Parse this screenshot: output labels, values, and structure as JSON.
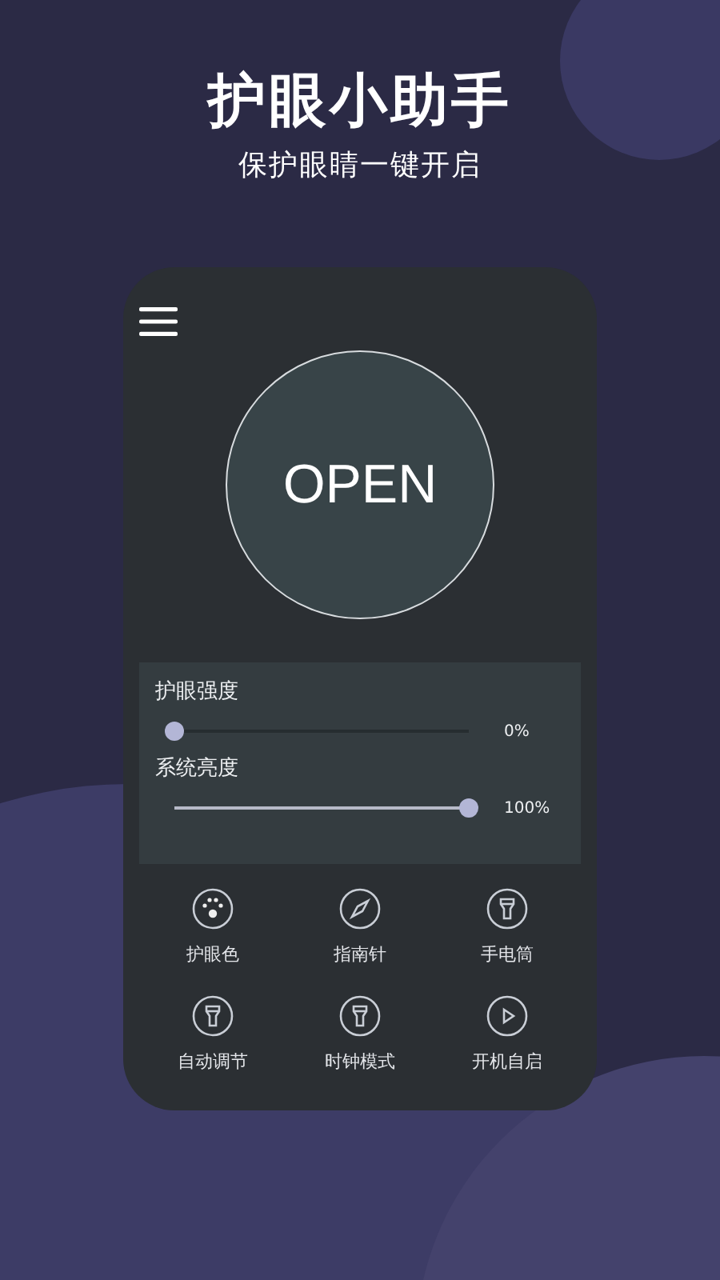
{
  "headline": {
    "title": "护眼小助手",
    "subtitle": "保护眼睛一键开启"
  },
  "app": {
    "power_button": "OPEN",
    "sliders": [
      {
        "label": "护眼强度",
        "level": 0,
        "reading": "0%"
      },
      {
        "label": "系统亮度",
        "level": 1,
        "reading": "100%"
      }
    ],
    "tools": [
      {
        "kind": "palette",
        "label": "护眼色"
      },
      {
        "kind": "compass",
        "label": "指南针"
      },
      {
        "kind": "flashlight",
        "label": "手电筒"
      },
      {
        "kind": "flashlight",
        "label": "自动调节"
      },
      {
        "kind": "flashlight",
        "label": "时钟模式"
      },
      {
        "kind": "play",
        "label": "开机自启"
      }
    ]
  }
}
